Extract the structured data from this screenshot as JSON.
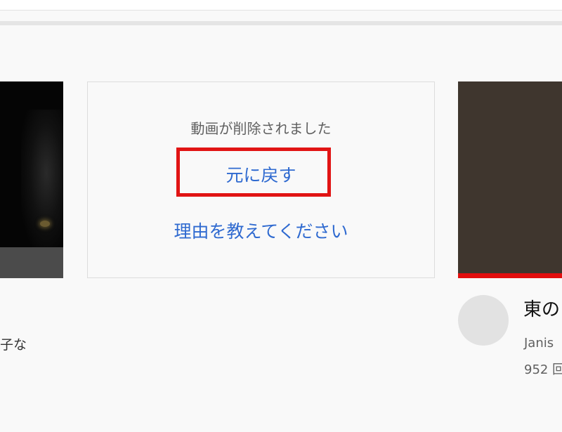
{
  "removed_card": {
    "message": "動画が削除されました",
    "undo_label": "元に戻す",
    "reason_label": "理由を教えてください"
  },
  "left_card": {
    "title_snippet": "子な"
  },
  "right_card": {
    "title_snippet": "東の",
    "channel_snippet": "Janis",
    "views_snippet": "952 回"
  },
  "colors": {
    "link": "#2f6ad0",
    "highlight_border": "#e11414",
    "progress": "#e20f0f",
    "background": "#f9f9f9"
  },
  "icons": {
    "channel_avatar": "avatar-placeholder"
  }
}
